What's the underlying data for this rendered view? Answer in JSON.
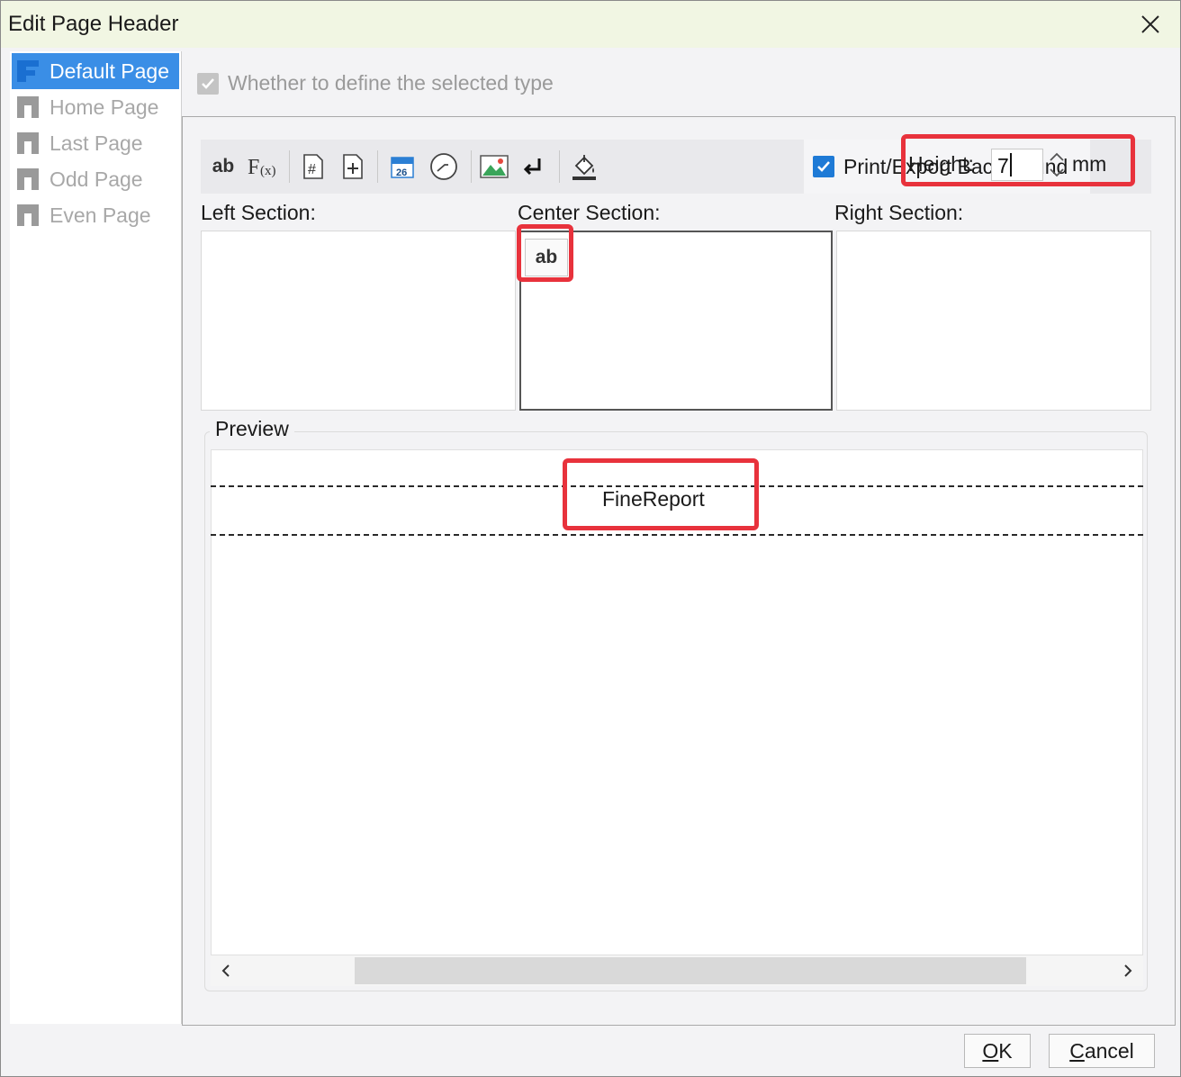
{
  "window": {
    "title": "Edit Page Header"
  },
  "sidebar": {
    "items": [
      {
        "label": "Default Page",
        "selected": true
      },
      {
        "label": "Home Page",
        "selected": false
      },
      {
        "label": "Last Page",
        "selected": false
      },
      {
        "label": "Odd Page",
        "selected": false
      },
      {
        "label": "Even Page",
        "selected": false
      }
    ]
  },
  "define_checkbox": {
    "label": "Whether to define the selected type",
    "checked": true,
    "disabled": true
  },
  "toolbar": {
    "text_button": "ab",
    "formula_button": "F(x)",
    "date_icon_text": "26",
    "print_background": {
      "label": "Print/Export Background",
      "checked": true
    },
    "height": {
      "label": "Height:",
      "value": "7",
      "unit": "mm"
    }
  },
  "sections": {
    "left_label": "Left Section:",
    "center_label": "Center Section:",
    "right_label": "Right Section:",
    "center_item": "ab"
  },
  "preview": {
    "title": "Preview",
    "text": "FineReport"
  },
  "buttons": {
    "ok": {
      "mnemonic": "O",
      "rest": "K"
    },
    "cancel": {
      "mnemonic": "C",
      "rest": "ancel"
    }
  },
  "colors": {
    "accent": "#3a8ee6",
    "checkbox_blue": "#1e7ad6",
    "highlight_red": "#e8323c",
    "titlebar": "#f1f6e3"
  }
}
